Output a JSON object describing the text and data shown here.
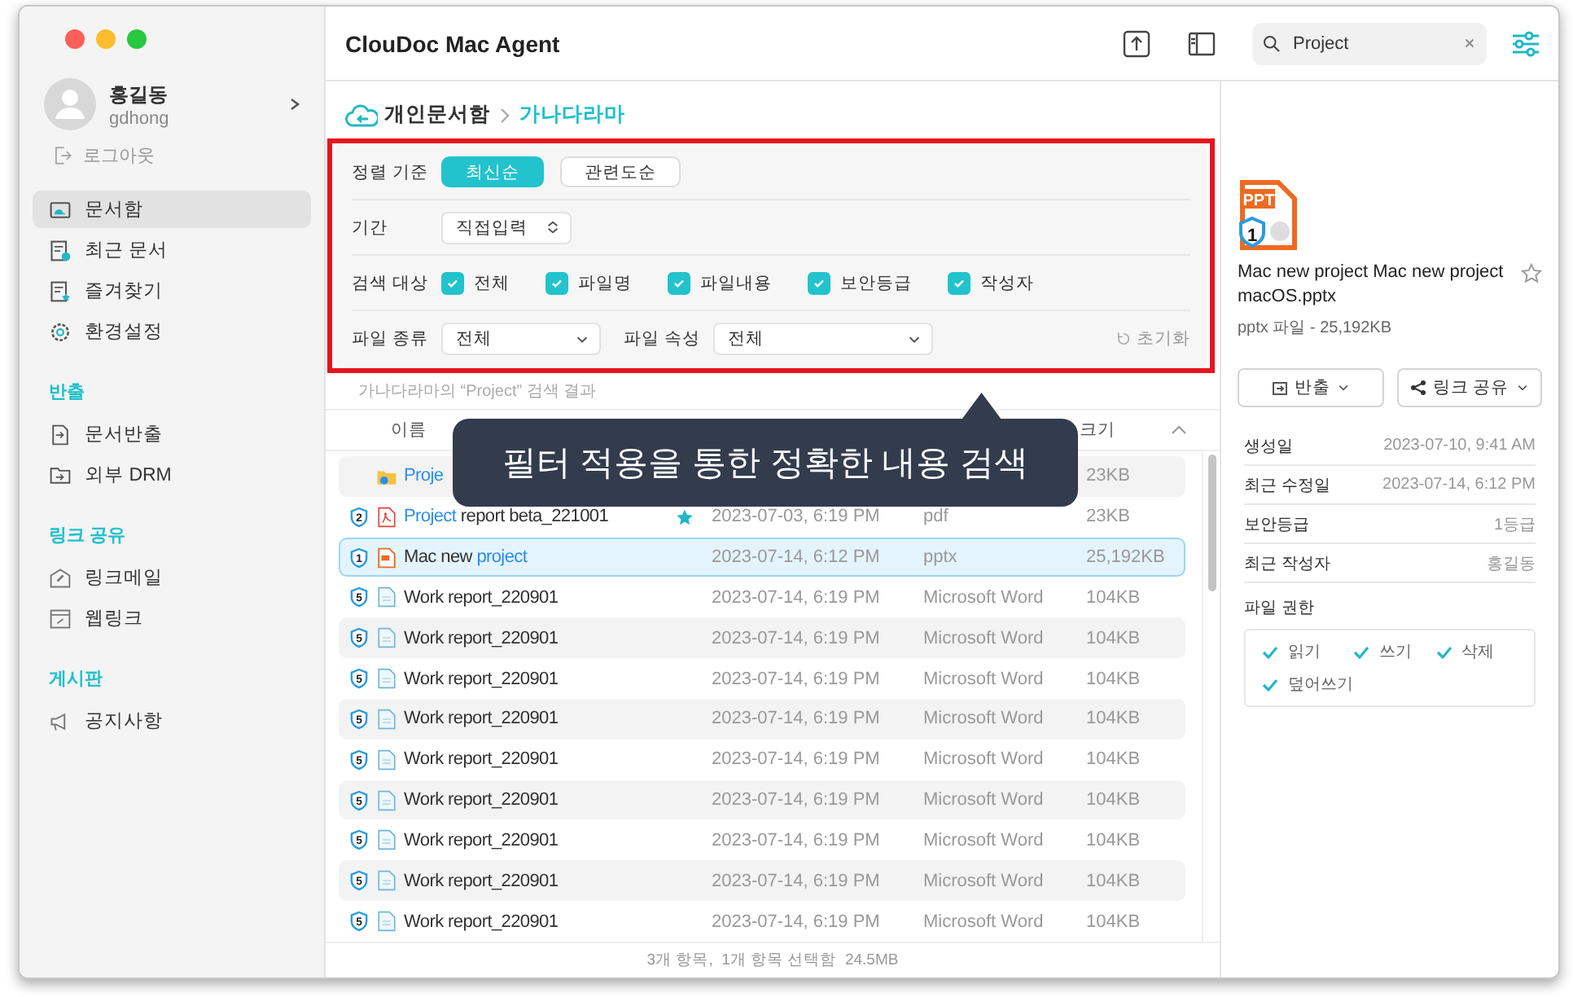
{
  "window": {
    "title": "ClouDoc Mac Agent"
  },
  "user": {
    "name": "홍길동",
    "id": "gdhong",
    "logout": "로그아웃"
  },
  "sidebar": {
    "sections": [
      {
        "items": [
          {
            "kind": "box",
            "label": "문서함",
            "selected": true
          },
          {
            "kind": "recent",
            "label": "최근 문서",
            "selected": false
          },
          {
            "kind": "favorite",
            "label": "즐겨찾기",
            "selected": false
          },
          {
            "kind": "settings",
            "label": "환경설정",
            "selected": false
          }
        ]
      },
      {
        "title": "반출",
        "items": [
          {
            "kind": "export",
            "label": "문서반출",
            "selected": false
          },
          {
            "kind": "drm",
            "label": "외부 DRM",
            "selected": false
          }
        ]
      },
      {
        "title": "링크 공유",
        "items": [
          {
            "kind": "linkmail",
            "label": "링크메일",
            "selected": false
          },
          {
            "kind": "weblink",
            "label": "웹링크",
            "selected": false
          }
        ]
      },
      {
        "title": "게시판",
        "items": [
          {
            "kind": "notice",
            "label": "공지사항",
            "selected": false
          }
        ]
      }
    ]
  },
  "search": {
    "value": "Project"
  },
  "breadcrumb": [
    {
      "label": "개인문서함",
      "current": false
    },
    {
      "label": "가나다라마",
      "current": true
    }
  ],
  "filters": {
    "sort": {
      "label": "정렬 기준",
      "options": [
        {
          "label": "최신순",
          "selected": true
        },
        {
          "label": "관련도순",
          "selected": false
        }
      ]
    },
    "period": {
      "label": "기간",
      "value": "직접입력"
    },
    "targets": {
      "label": "검색 대상",
      "options": [
        {
          "label": "전체",
          "checked": true
        },
        {
          "label": "파일명",
          "checked": true
        },
        {
          "label": "파일내용",
          "checked": true
        },
        {
          "label": "보안등급",
          "checked": true
        },
        {
          "label": "작성자",
          "checked": true
        }
      ]
    },
    "file_type": {
      "label": "파일 종류",
      "value": "전체"
    },
    "file_attr": {
      "label": "파일 속성",
      "value": "전체"
    },
    "reset": "초기화"
  },
  "result_caption": "가나다라마의 “Project” 검색 결과",
  "table": {
    "columns": [
      {
        "label": "이름"
      },
      {
        "label": "크기"
      }
    ],
    "rows": [
      {
        "kind": "folder",
        "name": [
          {
            "text": "Proje",
            "highlight": true
          }
        ],
        "starred": false,
        "selected": false,
        "size": "23KB"
      },
      {
        "kind": "pdf",
        "grade": "2",
        "name": [
          {
            "text": "Project",
            "highlight": true
          },
          {
            "text": " report beta_221001",
            "highlight": false
          }
        ],
        "starred": true,
        "selected": false,
        "date": "2023-07-03, 6:19 PM",
        "type": "pdf",
        "size": "23KB"
      },
      {
        "kind": "pptx",
        "grade": "1",
        "name": [
          {
            "text": "Mac new ",
            "highlight": false
          },
          {
            "text": "project",
            "highlight": true
          }
        ],
        "starred": false,
        "selected": true,
        "date": "2023-07-14, 6:12 PM",
        "type": "pptx",
        "size": "25,192KB"
      },
      {
        "kind": "word",
        "grade": "5",
        "name": [
          {
            "text": "Work report_220901",
            "highlight": false
          }
        ],
        "starred": false,
        "selected": false,
        "date": "2023-07-14, 6:19 PM",
        "type": "Microsoft Word",
        "size": "104KB"
      },
      {
        "kind": "word",
        "grade": "5",
        "name": [
          {
            "text": "Work report_220901",
            "highlight": false
          }
        ],
        "starred": false,
        "selected": false,
        "date": "2023-07-14, 6:19 PM",
        "type": "Microsoft Word",
        "size": "104KB"
      },
      {
        "kind": "word",
        "grade": "5",
        "name": [
          {
            "text": "Work report_220901",
            "highlight": false
          }
        ],
        "starred": false,
        "selected": false,
        "date": "2023-07-14, 6:19 PM",
        "type": "Microsoft Word",
        "size": "104KB"
      },
      {
        "kind": "word",
        "grade": "5",
        "name": [
          {
            "text": "Work report_220901",
            "highlight": false
          }
        ],
        "starred": false,
        "selected": false,
        "date": "2023-07-14, 6:19 PM",
        "type": "Microsoft Word",
        "size": "104KB"
      },
      {
        "kind": "word",
        "grade": "5",
        "name": [
          {
            "text": "Work report_220901",
            "highlight": false
          }
        ],
        "starred": false,
        "selected": false,
        "date": "2023-07-14, 6:19 PM",
        "type": "Microsoft Word",
        "size": "104KB"
      },
      {
        "kind": "word",
        "grade": "5",
        "name": [
          {
            "text": "Work report_220901",
            "highlight": false
          }
        ],
        "starred": false,
        "selected": false,
        "date": "2023-07-14, 6:19 PM",
        "type": "Microsoft Word",
        "size": "104KB"
      },
      {
        "kind": "word",
        "grade": "5",
        "name": [
          {
            "text": "Work report_220901",
            "highlight": false
          }
        ],
        "starred": false,
        "selected": false,
        "date": "2023-07-14, 6:19 PM",
        "type": "Microsoft Word",
        "size": "104KB"
      },
      {
        "kind": "word",
        "grade": "5",
        "name": [
          {
            "text": "Work report_220901",
            "highlight": false
          }
        ],
        "starred": false,
        "selected": false,
        "date": "2023-07-14, 6:19 PM",
        "type": "Microsoft Word",
        "size": "104KB"
      },
      {
        "kind": "word",
        "grade": "5",
        "name": [
          {
            "text": "Work report_220901",
            "highlight": false
          }
        ],
        "starred": false,
        "selected": false,
        "date": "2023-07-14, 6:19 PM",
        "type": "Microsoft Word",
        "size": "104KB"
      }
    ]
  },
  "status_bar": "3개 항목,  1개 항목 선택함  24.5MB",
  "tooltip": "필터 적용을 통한 정확한 내용 검색",
  "details": {
    "badge": "PPT",
    "grade": "1",
    "file_name": "Mac new project Mac new project macOS.pptx",
    "starred": false,
    "meta": "pptx 파일 - 25,192KB",
    "buttons": [
      {
        "kind": "export",
        "label": "반출"
      },
      {
        "kind": "share",
        "label": "링크 공유"
      }
    ],
    "info": [
      {
        "label": "생성일",
        "value": "2023-07-10, 9:41 AM"
      },
      {
        "label": "최근 수정일",
        "value": "2023-07-14, 6:12 PM"
      },
      {
        "label": "보안등급",
        "value": "1등급"
      },
      {
        "label": "최근 작성자",
        "value": "홍길동"
      }
    ],
    "permissions_label": "파일 권한",
    "permissions": [
      {
        "label": "읽기",
        "granted": true
      },
      {
        "label": "쓰기",
        "granted": true
      },
      {
        "label": "삭제",
        "granted": true
      },
      {
        "label": "덮어쓰기",
        "granted": true
      }
    ]
  }
}
